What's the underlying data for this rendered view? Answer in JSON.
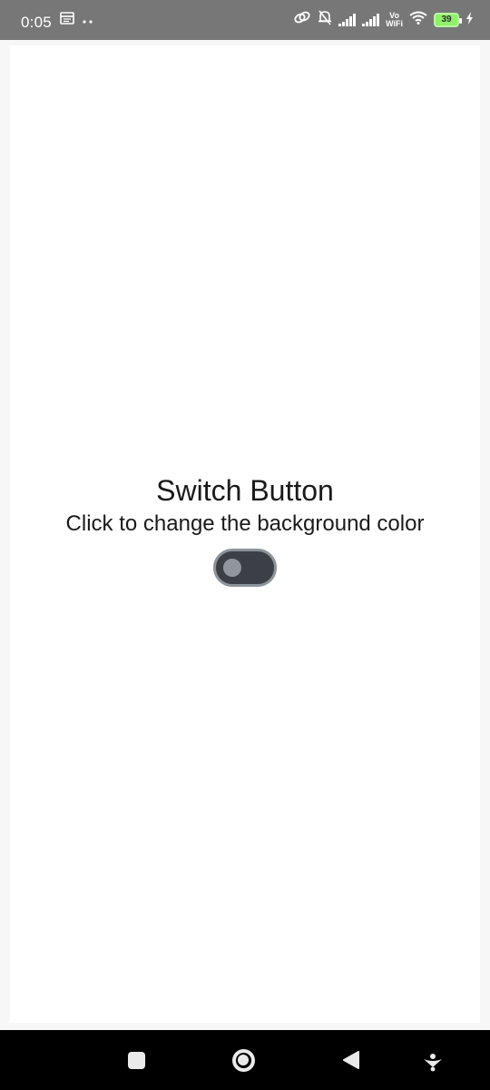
{
  "status_bar": {
    "time": "0:05",
    "battery_level": "39",
    "vowifi_top": "Vo",
    "vowifi_bottom": "WiFi",
    "icons": [
      "calendar-icon",
      "more-dots-icon",
      "link-icon",
      "muted-bell-icon",
      "signal-icon",
      "signal-icon",
      "wifi-icon",
      "battery-icon",
      "charging-icon"
    ]
  },
  "main": {
    "title": "Switch Button",
    "subtitle": "Click to change the background color",
    "switch": {
      "checked": false
    }
  },
  "nav_bar": {
    "icons": [
      "recents-square-icon",
      "home-circle-icon",
      "back-triangle-icon",
      "assistant-icon"
    ]
  },
  "colors": {
    "status_bar_bg": "#777777",
    "page_bg": "#ffffff",
    "switch_track": "#3c4046",
    "switch_border": "#8b939b",
    "battery_fill": "#8ff06a",
    "nav_bar_bg": "#000000"
  }
}
